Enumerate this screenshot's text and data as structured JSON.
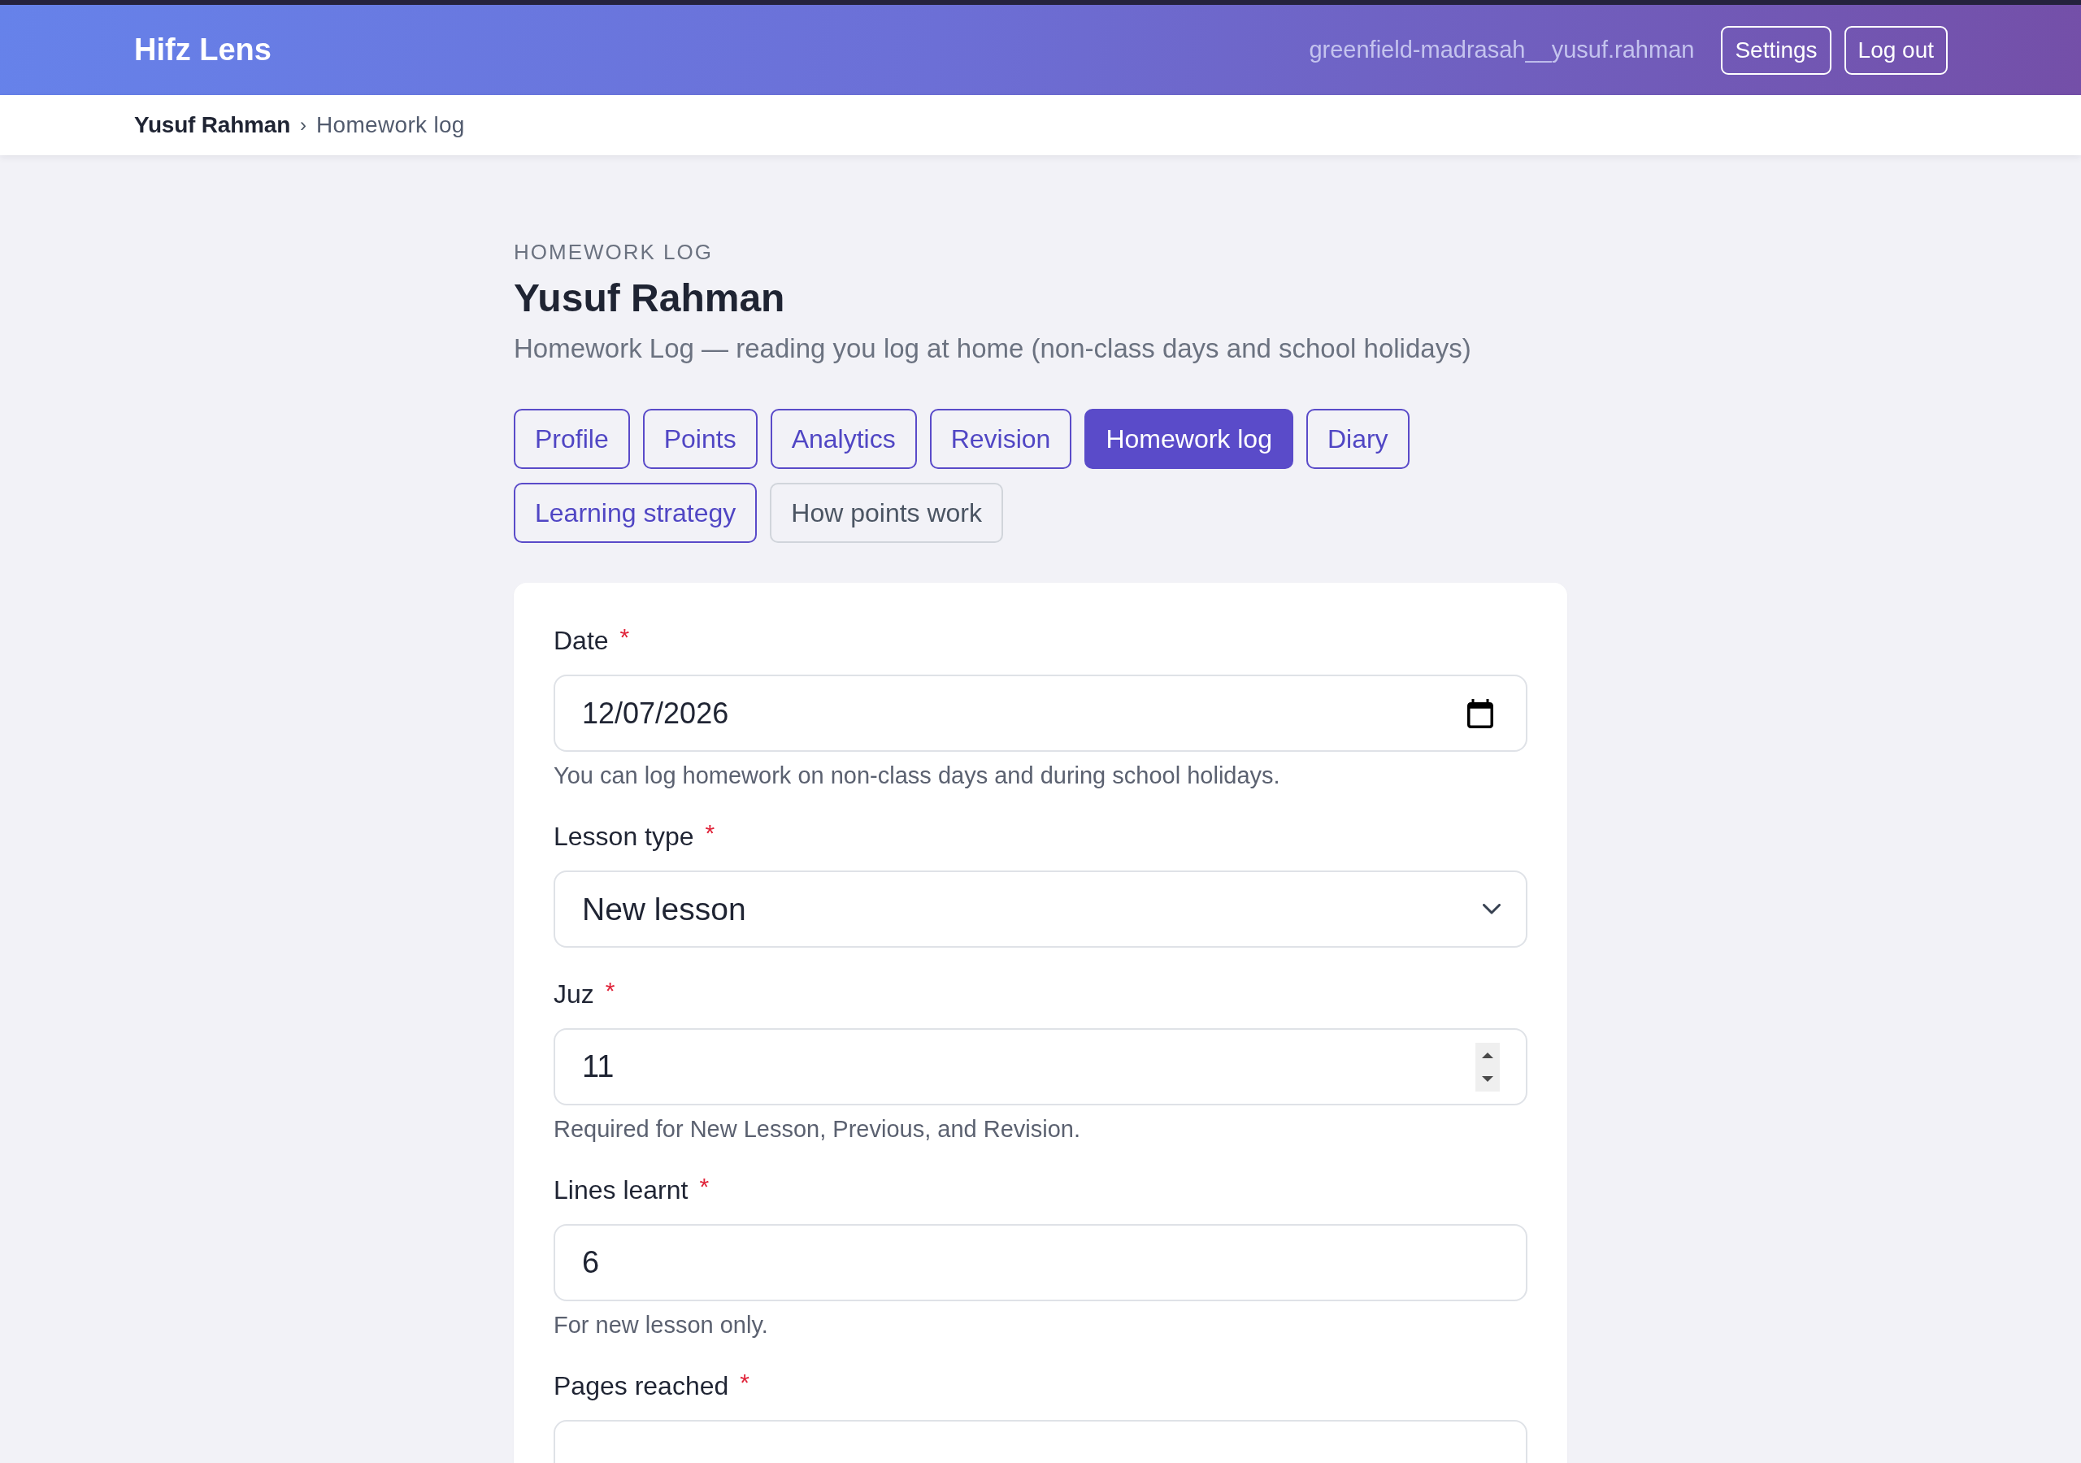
{
  "header": {
    "brand": "Hifz Lens",
    "account": "greenfield-madrasah__yusuf.rahman",
    "buttons": [
      "Settings",
      "Log out"
    ]
  },
  "breadcrumb": {
    "separator": "›",
    "items": [
      {
        "label": "Yusuf Rahman",
        "current": false
      },
      {
        "label": "Homework log",
        "current": true
      }
    ]
  },
  "page": {
    "eyebrow": "HOMEWORK LOG",
    "title": "Yusuf Rahman",
    "subtitle": "Homework Log — reading you log at home (non-class days and school holidays)"
  },
  "tabs": [
    {
      "label": "Profile",
      "kind": "tab",
      "selected": false
    },
    {
      "label": "Points",
      "kind": "tab",
      "selected": false
    },
    {
      "label": "Analytics",
      "kind": "tab",
      "selected": false
    },
    {
      "label": "Revision",
      "kind": "tab",
      "selected": false
    },
    {
      "label": "Homework log",
      "kind": "tab",
      "selected": true
    },
    {
      "label": "Diary",
      "kind": "tab",
      "selected": false
    },
    {
      "label": "Learning strategy",
      "kind": "tab",
      "selected": false
    },
    {
      "label": "How points work",
      "kind": "help",
      "selected": false
    }
  ],
  "form": {
    "fields": [
      {
        "kind": "date",
        "label": "Date",
        "required_mark": "*",
        "value": "12/07/2026",
        "help": "You can log homework on non-class days and during school holidays."
      },
      {
        "kind": "select",
        "label": "Lesson type",
        "required_mark": "*",
        "value": "New lesson"
      },
      {
        "kind": "number",
        "label": "Juz",
        "required_mark": "*",
        "value": "11",
        "help": "Required for New Lesson, Previous, and Revision."
      },
      {
        "kind": "text",
        "label": "Lines learnt",
        "required_mark": "*",
        "value": "6",
        "help": "For new lesson only."
      },
      {
        "kind": "text",
        "label": "Pages reached",
        "required_mark": "*"
      }
    ]
  }
}
